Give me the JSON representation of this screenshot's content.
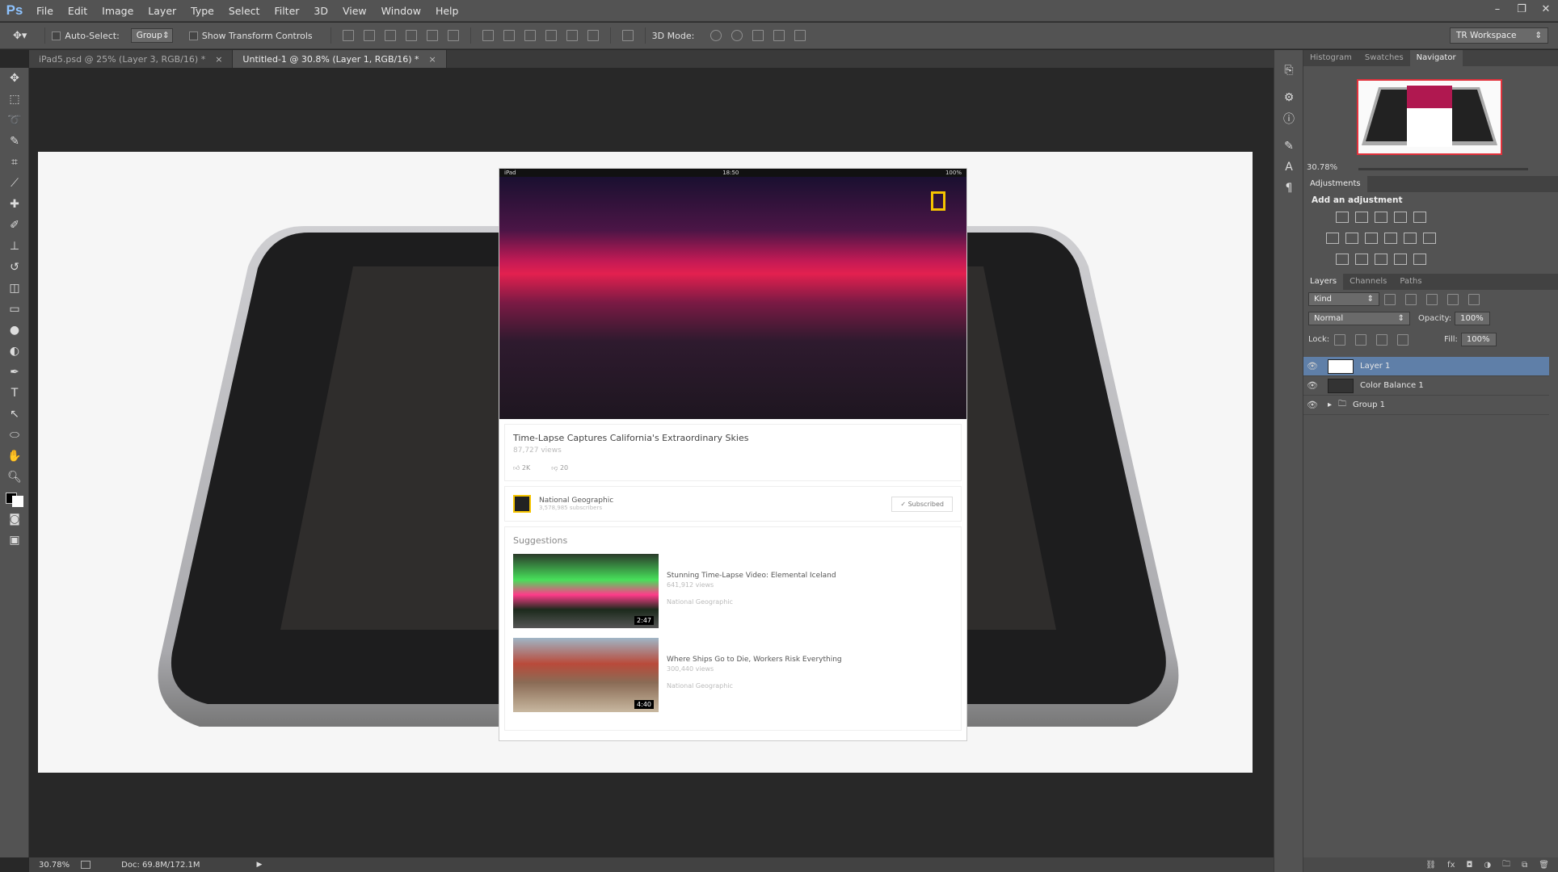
{
  "app": {
    "logo": "Ps"
  },
  "menu": [
    "File",
    "Edit",
    "Image",
    "Layer",
    "Type",
    "Select",
    "Filter",
    "3D",
    "View",
    "Window",
    "Help"
  ],
  "window_controls": [
    "–",
    "❐",
    "✕"
  ],
  "options": {
    "auto_select_label": "Auto-Select:",
    "auto_select_value": "Group",
    "show_transform_label": "Show Transform Controls",
    "mode_3d_label": "3D Mode:",
    "workspace": "TR Workspace"
  },
  "tabs": [
    {
      "label": "iPad5.psd @ 25% (Layer 3, RGB/16) *",
      "close": "×"
    },
    {
      "label": "Untitled-1 @ 30.8% (Layer 1, RGB/16) *",
      "close": "×"
    }
  ],
  "ipad": {
    "status_left": "iPad",
    "status_time": "18:50",
    "status_right": "100%",
    "video_title": "Time-Lapse Captures California's Extraordinary Skies",
    "video_views": "87,727 views",
    "likes": "2K",
    "dislikes": "20",
    "channel_name": "National Geographic",
    "channel_subs": "3,578,985 subscribers",
    "subscribed_label": "✓ Subscribed",
    "suggestions_heading": "Suggestions",
    "suggestions": [
      {
        "title": "Stunning Time-Lapse Video: Elemental Iceland",
        "views": "641,912 views",
        "channel": "National Geographic",
        "duration": "2:47"
      },
      {
        "title": "Where Ships Go to Die, Workers Risk Everything",
        "views": "300,440 views",
        "channel": "National Geographic",
        "duration": "4:40"
      }
    ]
  },
  "statusbar": {
    "zoom": "30.78%",
    "doc": "Doc: 69.8M/172.1M"
  },
  "navigator": {
    "tabs": [
      "Histogram",
      "Swatches",
      "Navigator"
    ],
    "zoom": "30.78%"
  },
  "adjustments": {
    "tab": "Adjustments",
    "heading": "Add an adjustment"
  },
  "layers_panel": {
    "tabs": [
      "Layers",
      "Channels",
      "Paths"
    ],
    "kind": "Kind",
    "blend": "Normal",
    "opacity_label": "Opacity:",
    "opacity": "100%",
    "lock_label": "Lock:",
    "fill_label": "Fill:",
    "fill": "100%",
    "layers": [
      "Layer 1",
      "Color Balance 1",
      "Group 1"
    ]
  },
  "colors": {
    "accent": "#5f7fa8",
    "navigator_box": "#e2323c"
  }
}
